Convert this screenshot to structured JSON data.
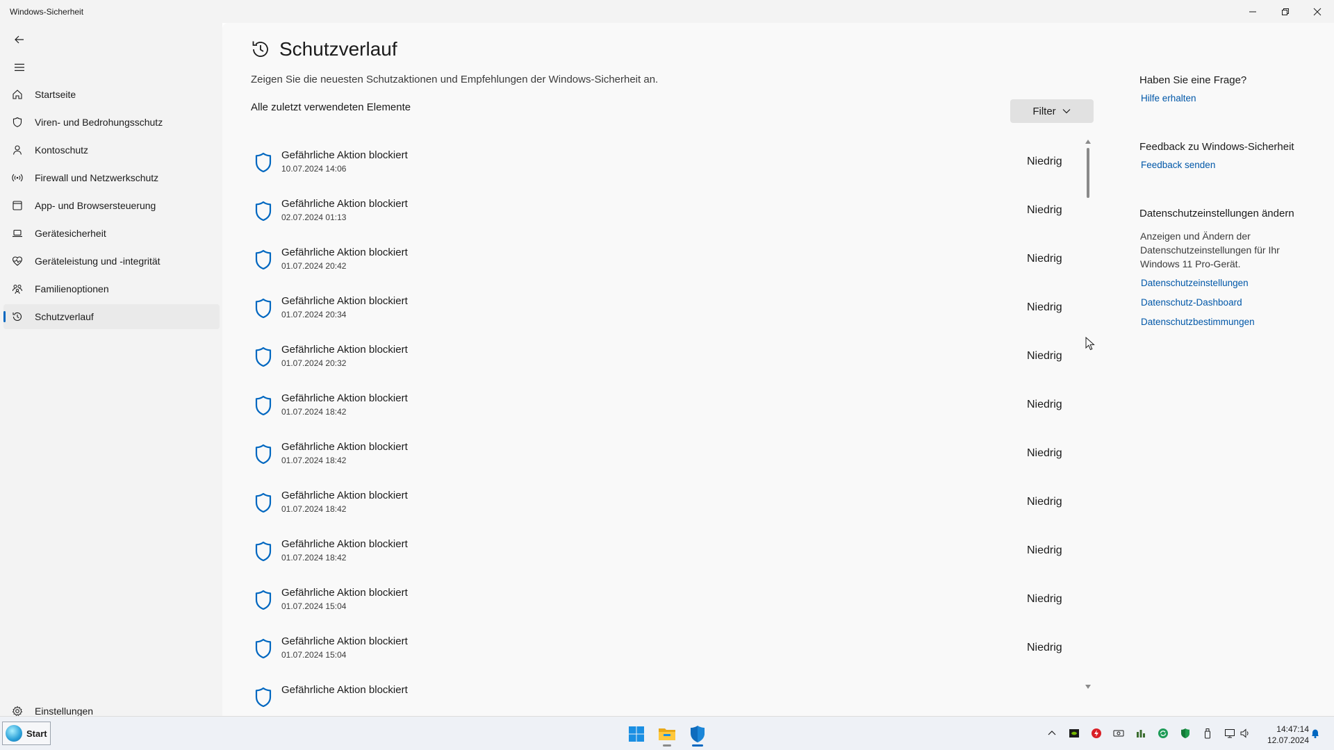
{
  "window": {
    "title": "Windows-Sicherheit"
  },
  "sidebar": {
    "items": [
      {
        "label": "Startseite",
        "icon": "home-icon"
      },
      {
        "label": "Viren- und Bedrohungsschutz",
        "icon": "shield-outline-icon"
      },
      {
        "label": "Kontoschutz",
        "icon": "person-icon"
      },
      {
        "label": "Firewall und Netzwerkschutz",
        "icon": "wifi-antenna-icon"
      },
      {
        "label": "App- und Browsersteuerung",
        "icon": "app-window-icon"
      },
      {
        "label": "Gerätesicherheit",
        "icon": "laptop-icon"
      },
      {
        "label": "Geräteleistung und -integrität",
        "icon": "heart-pulse-icon"
      },
      {
        "label": "Familienoptionen",
        "icon": "family-icon"
      },
      {
        "label": "Schutzverlauf",
        "icon": "history-icon",
        "active": true
      }
    ],
    "settings_label": "Einstellungen"
  },
  "main": {
    "title": "Schutzverlauf",
    "description": "Zeigen Sie die neuesten Schutzaktionen und Empfehlungen der Windows-Sicherheit an.",
    "section_label": "Alle zuletzt verwendeten Elemente",
    "filter_label": "Filter",
    "rows": [
      {
        "title": "Gefährliche Aktion blockiert",
        "date": "10.07.2024 14:06",
        "severity": "Niedrig"
      },
      {
        "title": "Gefährliche Aktion blockiert",
        "date": "02.07.2024 01:13",
        "severity": "Niedrig"
      },
      {
        "title": "Gefährliche Aktion blockiert",
        "date": "01.07.2024 20:42",
        "severity": "Niedrig"
      },
      {
        "title": "Gefährliche Aktion blockiert",
        "date": "01.07.2024 20:34",
        "severity": "Niedrig"
      },
      {
        "title": "Gefährliche Aktion blockiert",
        "date": "01.07.2024 20:32",
        "severity": "Niedrig"
      },
      {
        "title": "Gefährliche Aktion blockiert",
        "date": "01.07.2024 18:42",
        "severity": "Niedrig"
      },
      {
        "title": "Gefährliche Aktion blockiert",
        "date": "01.07.2024 18:42",
        "severity": "Niedrig"
      },
      {
        "title": "Gefährliche Aktion blockiert",
        "date": "01.07.2024 18:42",
        "severity": "Niedrig"
      },
      {
        "title": "Gefährliche Aktion blockiert",
        "date": "01.07.2024 18:42",
        "severity": "Niedrig"
      },
      {
        "title": "Gefährliche Aktion blockiert",
        "date": "01.07.2024 15:04",
        "severity": "Niedrig"
      },
      {
        "title": "Gefährliche Aktion blockiert",
        "date": "01.07.2024 15:04",
        "severity": "Niedrig"
      },
      {
        "title": "Gefährliche Aktion blockiert",
        "date": "",
        "severity": ""
      }
    ]
  },
  "right_panel": {
    "question_title": "Haben Sie eine Frage?",
    "help_link": "Hilfe erhalten",
    "feedback_title": "Feedback zu Windows-Sicherheit",
    "feedback_link": "Feedback senden",
    "privacy_title": "Datenschutzeinstellungen ändern",
    "privacy_text": "Anzeigen und Ändern der Datenschutzeinstellungen für Ihr Windows 11 Pro-Gerät.",
    "privacy_links": [
      "Datenschutzeinstellungen",
      "Datenschutz-Dashboard",
      "Datenschutzbestimmungen"
    ]
  },
  "taskbar": {
    "start_label": "Start",
    "apps": [
      "windows-logo-icon",
      "file-explorer-icon",
      "windows-security-icon"
    ],
    "tray_icons": [
      "chevron-up-icon",
      "nvidia-icon",
      "red-app-icon",
      "cd-drive-icon",
      "sound-blaster-icon",
      "sync-icon",
      "defender-shield-icon",
      "usb-eject-icon",
      "network-icon",
      "volume-icon"
    ],
    "time": "14:47:14",
    "date": "12.07.2024"
  },
  "colors": {
    "accent": "#0067c0",
    "link": "#0057a8",
    "shield_blue": "#0067c0"
  }
}
